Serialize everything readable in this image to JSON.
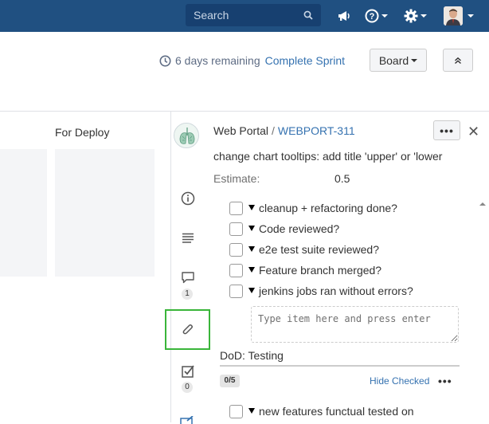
{
  "topbar": {
    "search_placeholder": "Search",
    "icons": [
      "search-icon",
      "megaphone-icon",
      "help-icon",
      "gear-icon",
      "user-avatar"
    ]
  },
  "sprint": {
    "remaining": "6 days remaining",
    "complete_label": "Complete Sprint",
    "board_label": "Board"
  },
  "board": {
    "column_title": "For Deploy"
  },
  "issue": {
    "project": "Web Portal",
    "separator": "/",
    "key": "WEBPORT-311",
    "more_label": "•••",
    "close_label": "✕",
    "summary": "change chart tooltips: add title 'upper' or 'lower",
    "estimate_label": "Estimate:",
    "estimate_value": "0.5"
  },
  "rail": {
    "comments_count": "1",
    "checklists_count": "0"
  },
  "checklist": {
    "items": [
      "cleanup + refactoring done?",
      "Code reviewed?",
      "e2e test suite reviewed?",
      "Feature branch merged?",
      "jenkins jobs ran without errors?"
    ],
    "new_item_placeholder": "Type item here and press enter"
  },
  "dod": {
    "title": "DoD: Testing",
    "progress": "0/5",
    "hide_checked_label": "Hide Checked",
    "more_label": "•••",
    "items": [
      "new features functual tested on"
    ]
  },
  "colors": {
    "topbar": "#205081",
    "link": "#3572b0",
    "highlight": "#3ab53a"
  }
}
